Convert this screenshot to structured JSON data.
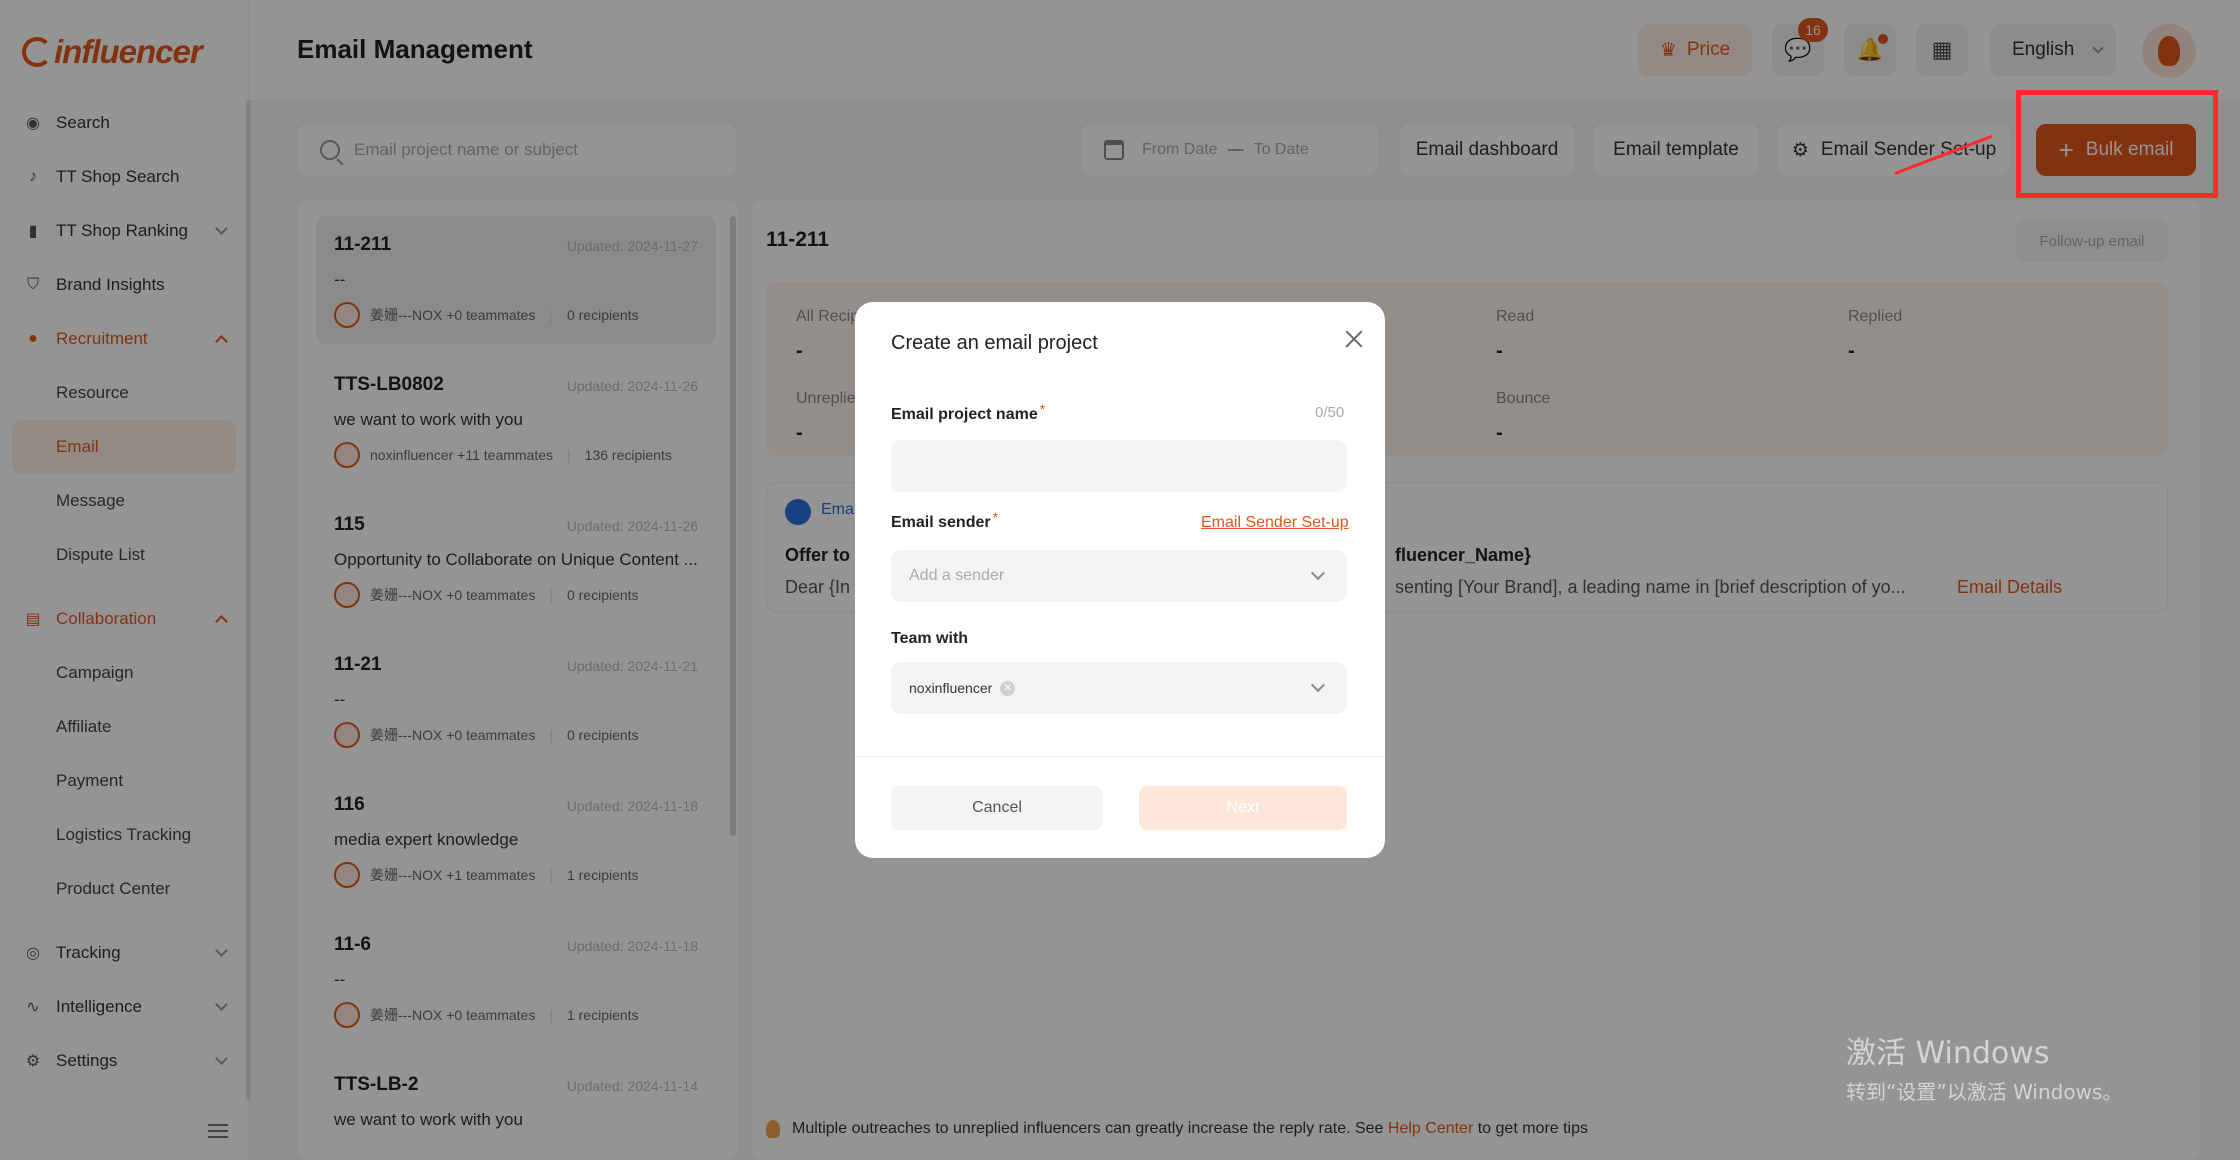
{
  "brand": {
    "logo_text": "influencer"
  },
  "sidebar": {
    "items": [
      {
        "label": "Search",
        "icon": "compass-icon"
      },
      {
        "label": "TT Shop Search",
        "icon": "tiktok-icon"
      },
      {
        "label": "TT Shop Ranking",
        "icon": "bar-chart-icon"
      },
      {
        "label": "Brand Insights",
        "icon": "shield-icon"
      },
      {
        "label": "Recruitment",
        "icon": "users-icon"
      },
      {
        "label": "Collaboration",
        "icon": "document-icon"
      },
      {
        "label": "Tracking",
        "icon": "target-icon"
      },
      {
        "label": "Intelligence",
        "icon": "pulse-icon"
      },
      {
        "label": "Settings",
        "icon": "gear-icon"
      }
    ],
    "recruitment_sub": [
      "Resource",
      "Email",
      "Message",
      "Dispute List"
    ],
    "collaboration_sub": [
      "Campaign",
      "Affiliate",
      "Payment",
      "Logistics Tracking",
      "Product Center"
    ]
  },
  "header": {
    "title": "Email Management",
    "price_label": "Price",
    "messages_badge": "16",
    "language": "English"
  },
  "toolbar": {
    "search_placeholder": "Email project name or subject",
    "from_date": "From Date",
    "dash": "—",
    "to_date": "To Date",
    "dashboard_label": "Email dashboard",
    "template_label": "Email template",
    "sender_setup_label": "Email Sender Set-up",
    "bulk_email_label": "Bulk email"
  },
  "projects": [
    {
      "name": "11-211",
      "updated": "Updated: 2024-11-27",
      "subject": "--",
      "owner": "姜姗---NOX",
      "teammates": "+0 teammates",
      "recipients": "0 recipients"
    },
    {
      "name": "TTS-LB0802",
      "updated": "Updated: 2024-11-26",
      "subject": "we want to work with you",
      "owner": "noxinfluencer",
      "teammates": "+11 teammates",
      "recipients": "136 recipients"
    },
    {
      "name": "115",
      "updated": "Updated: 2024-11-26",
      "subject": "Opportunity to Collaborate on Unique Content ...",
      "owner": "姜姗---NOX",
      "teammates": "+0 teammates",
      "recipients": "0 recipients"
    },
    {
      "name": "11-21",
      "updated": "Updated: 2024-11-21",
      "subject": "--",
      "owner": "姜姗---NOX",
      "teammates": "+0 teammates",
      "recipients": "0 recipients"
    },
    {
      "name": "116",
      "updated": "Updated: 2024-11-18",
      "subject": "media expert knowledge",
      "owner": "姜姗---NOX",
      "teammates": "+1 teammates",
      "recipients": "1 recipients"
    },
    {
      "name": "11-6",
      "updated": "Updated: 2024-11-18",
      "subject": "--",
      "owner": "姜姗---NOX",
      "teammates": "+0 teammates",
      "recipients": "1 recipients"
    },
    {
      "name": "TTS-LB-2",
      "updated": "Updated: 2024-11-14",
      "subject": "we want to work with you",
      "owner": "",
      "teammates": "",
      "recipients": ""
    }
  ],
  "detail": {
    "title": "11-211",
    "follow_up": "Follow-up email",
    "stats": {
      "all_recipients_label": "All Recip",
      "all_recipients": "-",
      "read_label": "Read",
      "read": "-",
      "replied_label": "Replied",
      "replied": "-",
      "unreplied_label": "Unreplie",
      "unreplied": "-",
      "bounce_label": "Bounce",
      "bounce": "-"
    },
    "template_tab": "Ema",
    "subject_left": "Offer to",
    "subject_right": "fluencer_Name}",
    "body_left": "Dear {In",
    "body_right": "senting [Your Brand], a leading name in [brief description of yo...",
    "details_link": "Email Details",
    "tip_before": "Multiple outreaches to unreplied influencers can greatly increase the reply rate. See",
    "tip_link": "Help Center",
    "tip_after": "to get more tips"
  },
  "modal": {
    "title": "Create an email project",
    "name_label": "Email project name",
    "required_mark": "*",
    "name_counter": "0/50",
    "name_value": "",
    "sender_label": "Email sender",
    "sender_setup_link": "Email Sender Set-up",
    "sender_placeholder": "Add a sender",
    "team_label": "Team with",
    "team_tag": "noxinfluencer",
    "cancel_label": "Cancel",
    "next_label": "Next"
  },
  "watermark": {
    "line1": "激活 Windows",
    "line2": "转到“设置”以激活 Windows。"
  },
  "colors": {
    "accent": "#e2561a",
    "highlight": "#ff2a2a"
  }
}
